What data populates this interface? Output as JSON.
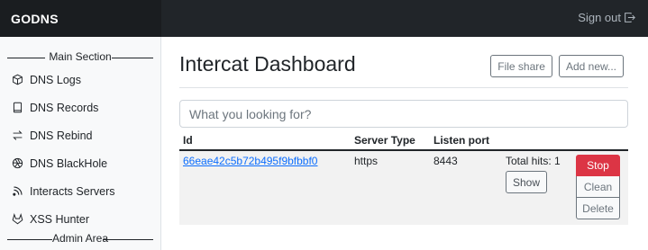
{
  "navbar": {
    "brand": "GODNS",
    "signout_label": "Sign out",
    "signout_icon": "box-arrow-right-icon"
  },
  "sidebar": {
    "main_section_label": "Main Section",
    "admin_section_label": "Admin Area",
    "items": [
      {
        "label": "DNS Logs",
        "icon": "box-icon"
      },
      {
        "label": "DNS Records",
        "icon": "book-icon"
      },
      {
        "label": "DNS Rebind",
        "icon": "arrow-repeat-icon"
      },
      {
        "label": "DNS BlackHole",
        "icon": "aperture-icon"
      },
      {
        "label": "Interacts Servers",
        "icon": "rss-icon"
      },
      {
        "label": "XSS Hunter",
        "icon": "gitlab-icon"
      }
    ]
  },
  "main": {
    "title": "Intercat Dashboard",
    "file_share_label": "File share",
    "add_new_label": "Add new...",
    "search_placeholder": "What you looking for?",
    "columns": [
      "Id",
      "Server Type",
      "Listen port"
    ],
    "rows": [
      {
        "id": "66eae42c5b72b495f9bfbbf0",
        "server_type": "https",
        "listen_port": "8443",
        "total_hits": "Total hits: 1",
        "show_label": "Show",
        "stop_label": "Stop",
        "clean_label": "Clean",
        "delete_label": "Delete"
      }
    ]
  },
  "colors": {
    "navbar_bg": "#212529",
    "danger": "#dc3545",
    "link": "#0d6efd",
    "secondary": "#6c757d"
  }
}
